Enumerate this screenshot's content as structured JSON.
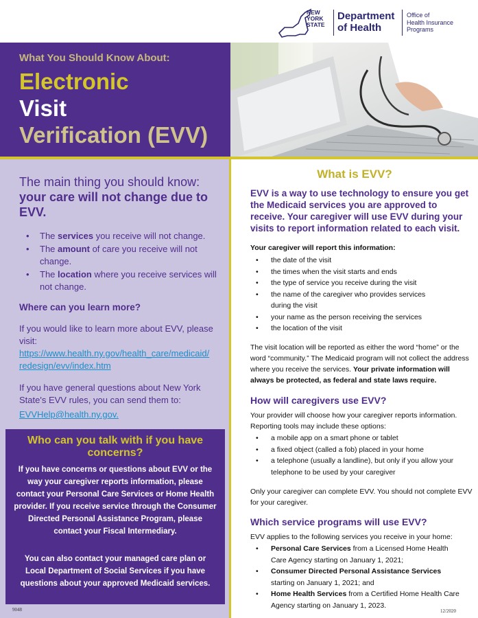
{
  "header": {
    "state_lines": [
      "NEW",
      "YORK",
      "STATE"
    ],
    "dept_lines": [
      "Department",
      "of Health"
    ],
    "office_lines": [
      "Office of",
      "Health Insurance",
      "Programs"
    ]
  },
  "hero": {
    "kicker": "What You Should Know About:",
    "title_1": "Electronic",
    "title_2": "Visit",
    "title_3": "Verification (EVV)"
  },
  "left": {
    "main_lead": "The main thing you should know:",
    "main_bold": "your care will not change due to EVV.",
    "bullets": [
      {
        "pre": "The ",
        "bold": "services",
        "post": " you receive will not change."
      },
      {
        "pre": "The ",
        "bold": "amount",
        "post": " of care you receive will not change."
      },
      {
        "pre": "The ",
        "bold": "location",
        "post": " where you receive services will not change."
      }
    ],
    "learn_heading": "Where can you learn more?",
    "learn_text": "If you would like to learn more about EVV, please visit:",
    "learn_link": "https://www.health.ny.gov/health_care/medicaid/redesign/evv/index.htm",
    "general_text": "If you have general questions about New York State's EVV rules, you can send them to:",
    "email": "EVVHelp@health.ny.gov."
  },
  "concern": {
    "heading": "Who can you talk with if you have concerns?",
    "p1": "If you have concerns or questions about EVV or the way your caregiver reports information, please contact your Personal Care Services or Home Health provider.  If you receive service through the Consumer Directed Personal Assistance Program, please contact your Fiscal Intermediary.",
    "p2": "You can also contact your managed care plan or Local Department of Social Services if you have questions about your approved Medicaid services."
  },
  "right": {
    "what_heading": "What is EVV?",
    "what_intro": "EVV is a way to use technology to ensure you get the Medicaid services you are approved to receive. Your caregiver will use EVV during your visits to report information related to each visit.",
    "report_label": "Your caregiver will report this information:",
    "report_items": [
      "the date of the visit",
      "the times when the visit starts and ends",
      "the type of service you receive during the visit",
      "the name of the caregiver who provides services during the visit",
      "your name as the person receiving the services",
      "the location of the visit"
    ],
    "location_text": "The visit location will be reported as either the word “home” or the word “community.”  The Medicaid program will not collect the address where you receive the services. ",
    "location_bold": "Your private information will always be protected, as federal and state laws require.",
    "how_heading": "How will caregivers use EVV?",
    "how_text": "Your provider will choose how your caregiver reports information. Reporting tools may include these options:",
    "how_items": [
      "a mobile app on a smart phone or tablet",
      "a fixed object (called a fob) placed in your home",
      "a telephone (usually a landline), but only if you allow your telephone to be used by your caregiver"
    ],
    "only_text": "Only your caregiver can complete EVV.  You should not complete EVV for your caregiver.",
    "which_heading": "Which service programs will use EVV?",
    "which_text": "EVV applies to the following services you receive in your home:",
    "which_items": [
      {
        "bold": "Personal Care Services",
        "rest": " from a Licensed Home Health Care Agency starting on January 1, 2021;"
      },
      {
        "bold": "Consumer Directed Personal Assistance Services",
        "rest": " starting on January 1, 2021; and"
      },
      {
        "bold": "Home Health Services",
        "rest": " from a Certified Home Health Care Agency starting on January 1, 2023."
      }
    ]
  },
  "footer": {
    "left_code": "9048",
    "right_date": "12/2020"
  }
}
